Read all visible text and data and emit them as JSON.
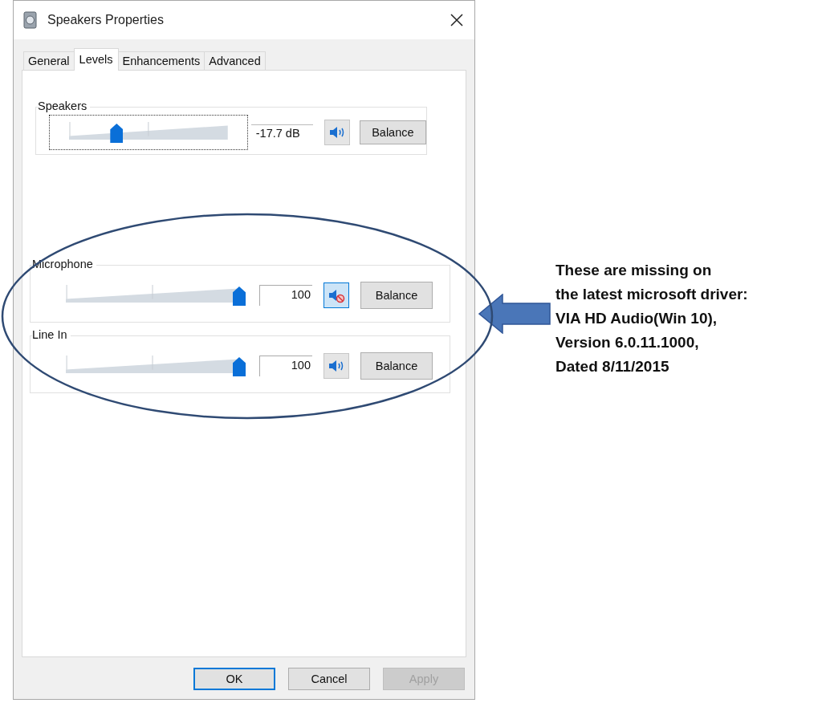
{
  "window": {
    "title": "Speakers Properties"
  },
  "tabs": [
    {
      "label": "General",
      "selected": false
    },
    {
      "label": "Levels",
      "selected": true
    },
    {
      "label": "Enhancements",
      "selected": false
    },
    {
      "label": "Advanced",
      "selected": false
    }
  ],
  "channels": [
    {
      "name": "Speakers",
      "kind": "output",
      "level": 0.3,
      "reading": "-17.7 dB",
      "muted": false,
      "focused": true,
      "button": "Balance"
    },
    {
      "name": "Microphone",
      "kind": "input",
      "level": 1,
      "reading": "100",
      "muted": true,
      "focused": false,
      "button": "Balance"
    },
    {
      "name": "Line In",
      "kind": "input",
      "level": 1,
      "reading": "100",
      "muted": false,
      "focused": false,
      "button": "Balance"
    }
  ],
  "buttons": [
    {
      "label": "OK",
      "kind": "default",
      "disabled": false
    },
    {
      "label": "Cancel",
      "kind": "normal",
      "disabled": false
    },
    {
      "label": "Apply",
      "kind": "normal",
      "disabled": true
    }
  ],
  "annotation": {
    "text": "These are missing on\nthe latest microsoft driver:\nVIA HD Audio(Win 10),\nVersion 6.0.11.1000,\nDated 8/11/2015"
  }
}
